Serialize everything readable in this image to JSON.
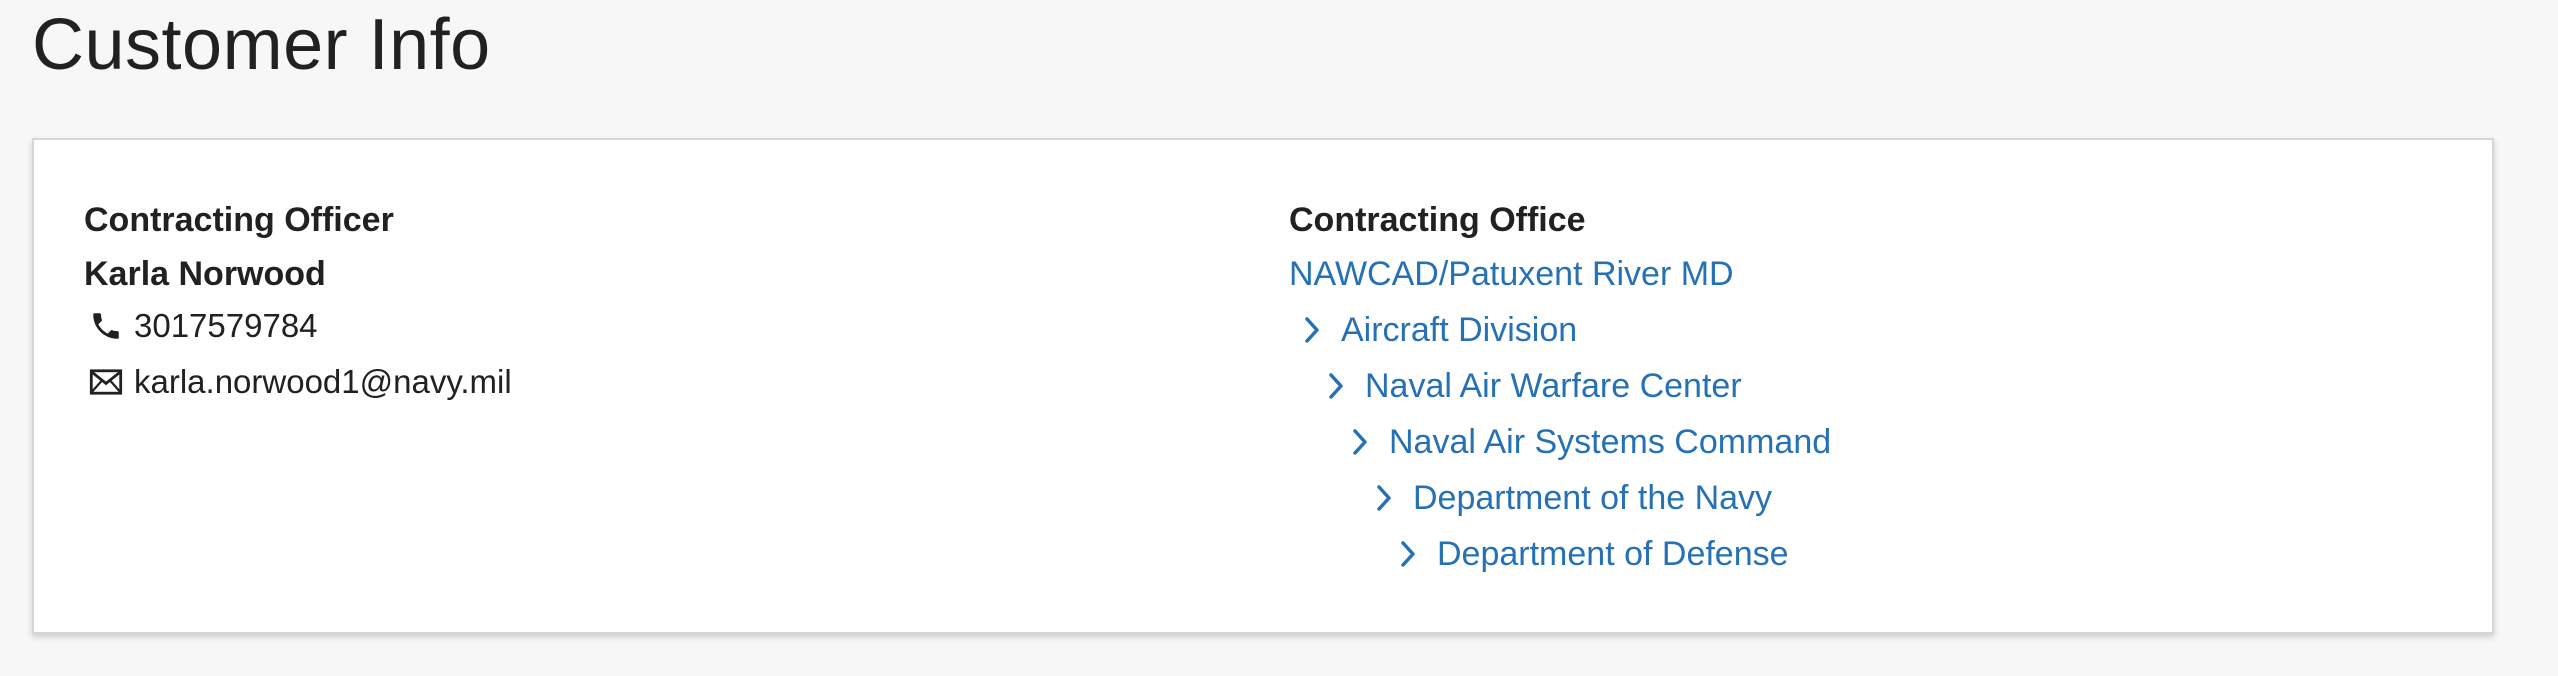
{
  "page": {
    "title": "Customer Info"
  },
  "officer": {
    "heading": "Contracting Officer",
    "name": "Karla Norwood",
    "phone": "3017579784",
    "email": "karla.norwood1@navy.mil",
    "phone_icon": "phone-icon",
    "email_icon": "envelope-icon"
  },
  "office": {
    "heading": "Contracting Office",
    "name": "NAWCAD/Patuxent River MD",
    "hierarchy": [
      "Aircraft Division",
      "Naval Air Warfare Center",
      "Naval Air Systems Command",
      "Department of the Navy",
      "Department of Defense"
    ],
    "chevron_icon": "chevron-right-icon"
  },
  "colors": {
    "link": "#2671b5",
    "text": "#212121",
    "background": "#f7f7f7",
    "card": "#ffffff"
  }
}
